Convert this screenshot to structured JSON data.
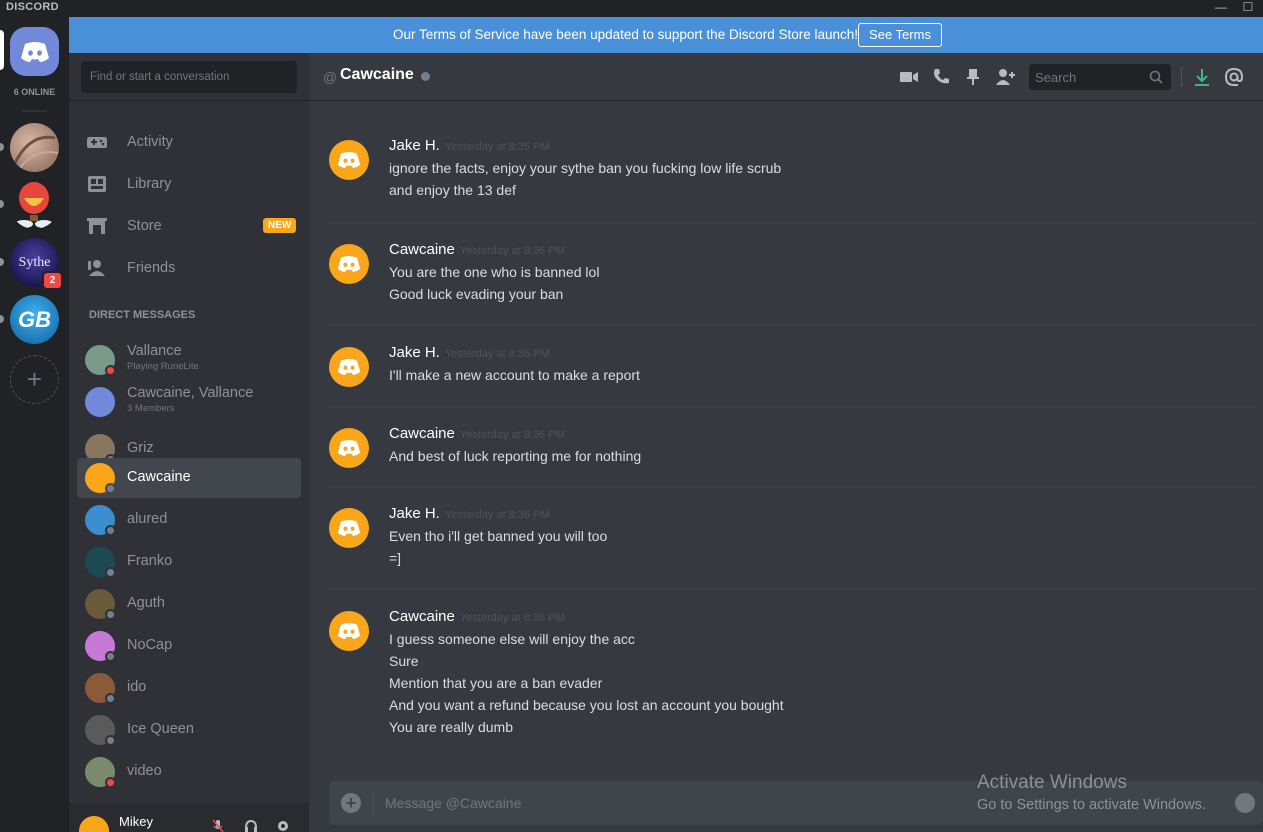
{
  "window": {
    "brand": "DISCORD",
    "minimize_glyph": "—",
    "maximize_glyph": "☐"
  },
  "banner": {
    "text": "Our Terms of Service have been updated to support the Discord Store launch!",
    "button": "See Terms"
  },
  "rail": {
    "online_count": "6 ONLINE",
    "guilds": [
      {
        "name": "guild-1"
      },
      {
        "name": "guild-balloon"
      },
      {
        "name": "Sythe",
        "label": "Sythe",
        "badge": "2"
      },
      {
        "name": "GB",
        "label": "GB"
      }
    ],
    "add_glyph": "+"
  },
  "sidebar": {
    "search_placeholder": "Find or start a conversation",
    "nav": [
      {
        "label": "Activity",
        "icon": "gamepad-icon"
      },
      {
        "label": "Library",
        "icon": "library-icon"
      },
      {
        "label": "Store",
        "icon": "store-icon",
        "badge": "NEW"
      },
      {
        "label": "Friends",
        "icon": "friends-icon"
      }
    ],
    "dm_header": "DIRECT MESSAGES",
    "dms": [
      {
        "name": "Vallance",
        "sub": "Playing RuneLite",
        "status": "dnd",
        "color": "#7a9a8a"
      },
      {
        "name": "Cawcaine, Vallance",
        "sub": "3 Members",
        "status": "none",
        "color": "#7289da"
      },
      {
        "name": "Griz",
        "status": "offline",
        "color": "#8a7560"
      },
      {
        "name": "Cawcaine",
        "status": "offline",
        "color": "#faa61a",
        "active": true
      },
      {
        "name": "alured",
        "status": "offline",
        "color": "#3b8fd1"
      },
      {
        "name": "Franko",
        "status": "offline",
        "color": "#1c4a52"
      },
      {
        "name": "Aguth",
        "status": "offline",
        "color": "#6b5a3a"
      },
      {
        "name": "NoCap",
        "status": "offline",
        "color": "#c879d6"
      },
      {
        "name": "ido",
        "status": "offline",
        "color": "#8a5a3a"
      },
      {
        "name": "Ice Queen",
        "status": "offline",
        "color": "#5a5a5a"
      },
      {
        "name": "video",
        "status": "dnd",
        "color": "#7a8a6a"
      }
    ],
    "user": {
      "name": "Mikey"
    }
  },
  "chat": {
    "at_symbol": "@",
    "recipient": "Cawcaine",
    "search_placeholder": "Search",
    "composer_placeholder": "Message @Cawcaine",
    "messages": [
      {
        "author": "Jake H.",
        "time": "Yesterday at 8:35 PM",
        "lines": [
          "ignore the facts, enjoy your sythe ban you fucking low life scrub",
          "and enjoy the 13 def"
        ]
      },
      {
        "author": "Cawcaine",
        "time": "Yesterday at 8:36 PM",
        "lines": [
          "You are the one who is banned lol",
          "Good luck evading your ban"
        ]
      },
      {
        "author": "Jake H.",
        "time": "Yesterday at 8:36 PM",
        "lines": [
          "I'll make a new account to make a report"
        ]
      },
      {
        "author": "Cawcaine",
        "time": "Yesterday at 8:36 PM",
        "lines": [
          "And best of luck reporting me for nothing"
        ]
      },
      {
        "author": "Jake H.",
        "time": "Yesterday at 8:36 PM",
        "lines": [
          "Even tho i'll get banned you will too",
          "=]"
        ]
      },
      {
        "author": "Cawcaine",
        "time": "Yesterday at 8:36 PM",
        "lines": [
          "I guess someone else will enjoy the acc",
          "Sure",
          "Mention that you are a ban evader",
          "And you want a refund because you lost an account you bought",
          "You are really dumb"
        ]
      }
    ]
  },
  "watermark": {
    "line1": "Activate Windows",
    "line2": "Go to Settings to activate Windows."
  },
  "colors": {
    "accent": "#7289da",
    "banner": "#4a90d9",
    "avatar_orange": "#faa61a",
    "dnd": "#f04747",
    "offline": "#747f8d",
    "download_green": "#43b581"
  }
}
